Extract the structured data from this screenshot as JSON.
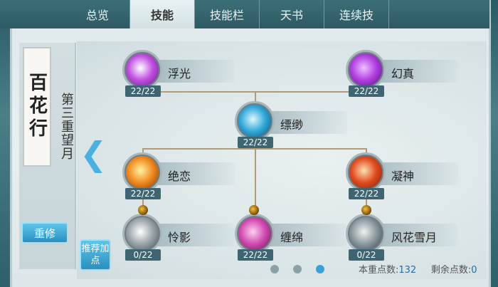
{
  "tabs": [
    "总览",
    "技能",
    "技能栏",
    "天书",
    "连续技"
  ],
  "active_tab": "技能",
  "school": "百花行",
  "realm": "第三重望月",
  "reset_label": "重修",
  "recommend_label": "推荐加点",
  "skills": [
    {
      "name": "浮光",
      "level": "22/22",
      "colors": [
        "#ffffff",
        "#c04de0",
        "#4a1a6a"
      ]
    },
    {
      "name": "幻真",
      "level": "22/22",
      "colors": [
        "#f0c0ff",
        "#b03de0",
        "#3a1060"
      ]
    },
    {
      "name": "缥缈",
      "level": "22/22",
      "colors": [
        "#e0f8ff",
        "#2fa8d8",
        "#103a5a"
      ]
    },
    {
      "name": "绝恋",
      "level": "22/22",
      "colors": [
        "#fff4a0",
        "#f08a20",
        "#6a2a08"
      ]
    },
    {
      "name": "凝神",
      "level": "22/22",
      "colors": [
        "#ffe0b0",
        "#e04a20",
        "#5a1a08"
      ]
    },
    {
      "name": "怜影",
      "level": "0/22",
      "colors": [
        "#ffffff",
        "#9aa4aa",
        "#3a4248"
      ]
    },
    {
      "name": "缠绵",
      "level": "22/22",
      "colors": [
        "#ffd0f0",
        "#d04ab0",
        "#4a1040"
      ]
    },
    {
      "name": "风花雪月",
      "level": "0/22",
      "colors": [
        "#f0f0f0",
        "#8a9aa0",
        "#2a3238"
      ]
    }
  ],
  "page_count": 3,
  "active_page": 3,
  "points": {
    "total_label": "本重点数:",
    "total_value": "132",
    "remain_label": "剩余点数:",
    "remain_value": "0"
  },
  "colors": {
    "accent": "#3aa1d8",
    "connector": "#b09c7a"
  }
}
